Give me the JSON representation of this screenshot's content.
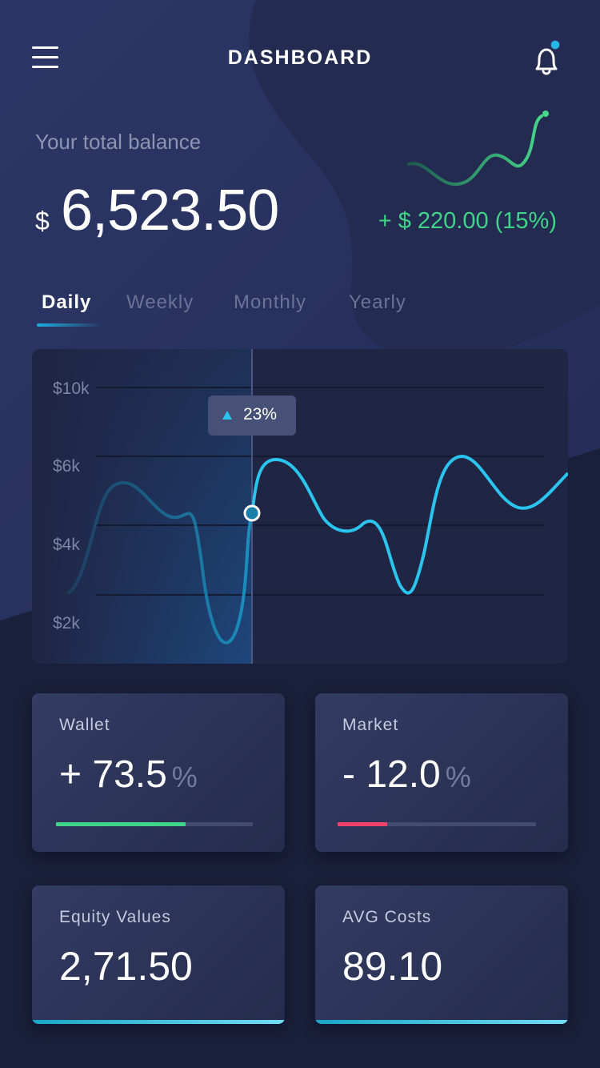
{
  "header": {
    "title": "DASHBOARD",
    "menu_icon": "hamburger-menu-icon",
    "bell_icon": "bell-icon",
    "notification_dot_color": "#24b8e6"
  },
  "balance": {
    "label": "Your total balance",
    "currency": "$",
    "value": "6,523.50",
    "change": "+ $ 220.00 (15%)",
    "change_color": "#3fd589"
  },
  "tabs": [
    {
      "label": "Daily",
      "active": true
    },
    {
      "label": "Weekly",
      "active": false
    },
    {
      "label": "Monthly",
      "active": false
    },
    {
      "label": "Yearly",
      "active": false
    }
  ],
  "chart_data": {
    "type": "line",
    "y_tick_labels": [
      "$10k",
      "$6k",
      "$4k",
      "$2k"
    ],
    "tooltip": "23%",
    "line_color": "#2bc4ee",
    "highlight_color": "#1e4a82"
  },
  "cards": {
    "wallet": {
      "label": "Wallet",
      "sign": "+",
      "value": "73.5",
      "unit": "%",
      "progress": 0.66,
      "color": "#3fd589"
    },
    "market": {
      "label": "Market",
      "sign": "-",
      "value": "12.0",
      "unit": "%",
      "progress": 0.25,
      "color": "#f0426b"
    },
    "equity": {
      "label": "Equity Values",
      "value": "2,71.50"
    },
    "avg_costs": {
      "label": "AVG Costs",
      "value": "89.10"
    }
  }
}
